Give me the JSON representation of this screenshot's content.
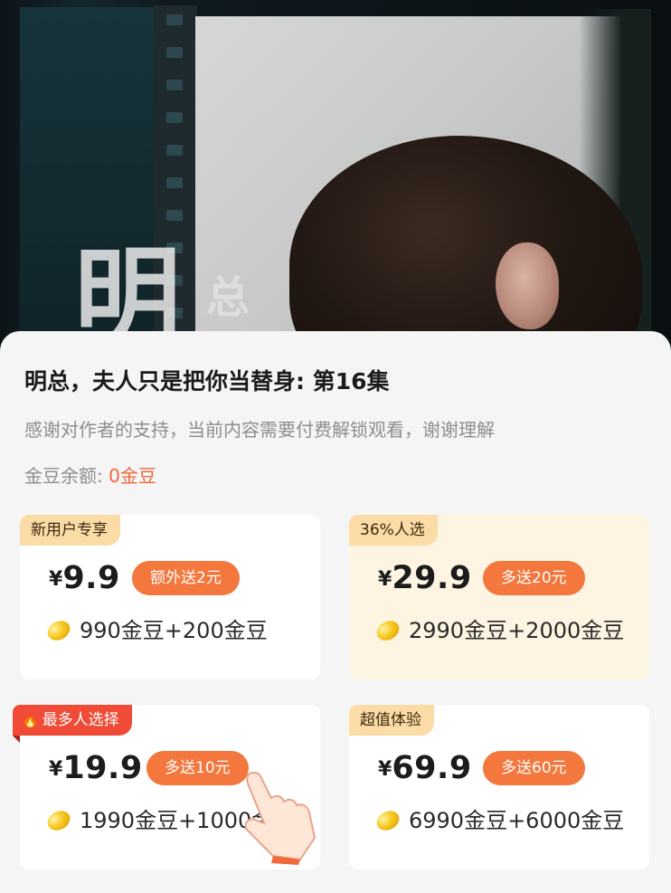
{
  "episode": {
    "title": "明总，夫人只是把你当替身: 第16集",
    "notice": "感谢对作者的支持，当前内容需要付费解锁观看，谢谢理解",
    "balance_label": "金豆余额: ",
    "balance_value": "0金豆"
  },
  "video": {
    "overlay_title_large": "明",
    "overlay_title_small": "总"
  },
  "packages": [
    {
      "tag": "新用户专享",
      "currency": "¥",
      "price": "9.9",
      "bonus": "额外送2元",
      "beans": "990金豆+200金豆",
      "highlight": false
    },
    {
      "tag": "36%人选",
      "currency": "¥",
      "price": "29.9",
      "bonus": "多送20元",
      "beans": "2990金豆+2000金豆",
      "highlight": true
    },
    {
      "tag": "最多人选择",
      "currency": "¥",
      "price": "19.9",
      "bonus": "多送10元",
      "beans": "1990金豆+1000金豆",
      "highlight": false,
      "hot": true
    },
    {
      "tag": "超值体验",
      "currency": "¥",
      "price": "69.9",
      "bonus": "多送60元",
      "beans": "6990金豆+6000金豆",
      "highlight": false
    }
  ],
  "icons": {
    "bean": "gold-bean-icon",
    "flame": "flame-icon",
    "pointer": "pointing-hand-icon"
  },
  "colors": {
    "accent": "#f4773e",
    "balance": "#f0663a",
    "tag_bg": "#fbdca6",
    "hot_tag_bg": "#ef4b37",
    "highlight_card_bg": "#fdf5e2"
  }
}
